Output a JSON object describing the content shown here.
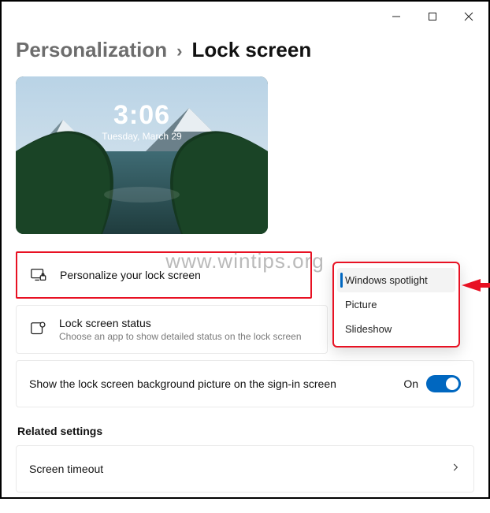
{
  "titlebar": {},
  "breadcrumb": {
    "parent": "Personalization",
    "sep": "›",
    "current": "Lock screen"
  },
  "preview": {
    "time": "3:06",
    "date": "Tuesday, March 29"
  },
  "watermark": "www.wintips.org",
  "rows": {
    "personalize": {
      "title": "Personalize your lock screen"
    },
    "status": {
      "title": "Lock screen status",
      "sub": "Choose an app to show detailed status on the lock screen"
    },
    "signin": {
      "title": "Show the lock screen background picture on the sign-in screen",
      "toggle_label": "On",
      "toggle_on": true
    }
  },
  "dropdown": {
    "items": [
      {
        "label": "Windows spotlight",
        "selected": true
      },
      {
        "label": "Picture",
        "selected": false
      },
      {
        "label": "Slideshow",
        "selected": false
      }
    ]
  },
  "related": {
    "heading": "Related settings",
    "timeout": "Screen timeout"
  }
}
